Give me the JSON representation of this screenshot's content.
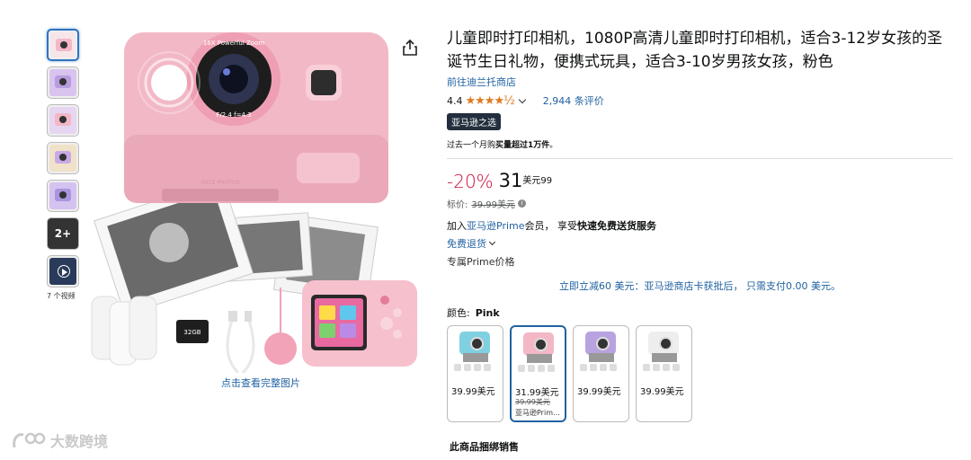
{
  "thumbnails": {
    "more_label": "2+",
    "video_count_label": "7 个视频"
  },
  "gallery": {
    "full_image_link": "点击查看完整图片",
    "lens_text_top": "16X Powerful Zoom",
    "lens_text_bottom": "F/2.4 f=4.3",
    "brand_text": "GKTZ PHOTOS",
    "card_label": "32GB"
  },
  "product": {
    "title": "儿童即时打印相机，1080P高清儿童即时打印相机，适合3-12岁女孩的圣诞节生日礼物，便携式玩具，适合3-10岁男孩女孩，粉色",
    "store_link": "前往迪兰托商店",
    "rating": "4.4",
    "stars": "★★★★½",
    "reviews": "2,944 条评价",
    "badge": "亚马逊之选",
    "bought_prefix": "过去一个月购",
    "bought_bold": "买量超过1万件",
    "bought_suffix": "。"
  },
  "price": {
    "discount": "-20%",
    "whole": "31",
    "sup": "美元99",
    "list_label": "标价:",
    "list_price": "39.99美元",
    "info": "i"
  },
  "delivery": {
    "prime_prefix": "加入",
    "prime_link": "亚马逊Prime",
    "prime_middle": "会员， 享受",
    "prime_bold": "快速免费送货服务",
    "returns": "免费退货",
    "prime_price": "专属Prime价格",
    "promo": "立即立减60 美元：亚马逊商店卡获批后， 只需支付0.00 美元。"
  },
  "color": {
    "label": "颜色:",
    "selected": "Pink",
    "swatches": [
      {
        "color": "#7fd0e0",
        "price": "39.99美元",
        "old": "",
        "note": ""
      },
      {
        "color": "#f3b7c6",
        "price": "31.99美元",
        "old": "39.99美元",
        "note": "亚马逊Prim…"
      },
      {
        "color": "#b9a2e0",
        "price": "39.99美元",
        "old": "",
        "note": ""
      },
      {
        "color": "#eeeeee",
        "price": "39.99美元",
        "old": "",
        "note": ""
      }
    ]
  },
  "bundle_heading": "此商品捆绑销售",
  "watermark": "大数跨境",
  "colors": {
    "link": "#2162a1",
    "star": "#de7921",
    "discount": "#cc0c39",
    "camera_pink": "#f2b8c6"
  }
}
